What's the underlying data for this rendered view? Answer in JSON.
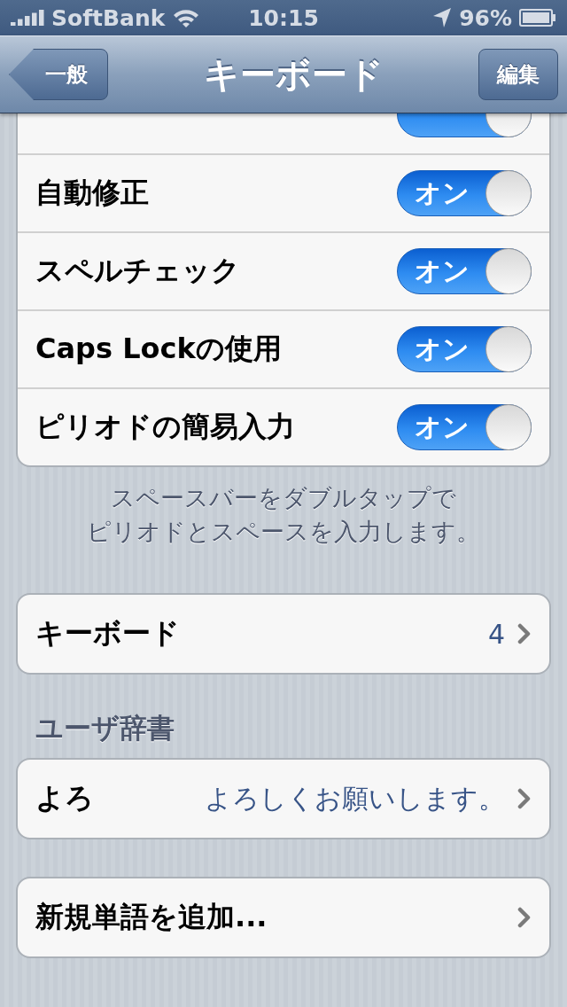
{
  "status_bar": {
    "carrier": "SoftBank",
    "time": "10:15",
    "battery": "96%"
  },
  "nav_bar": {
    "back": "一般",
    "title": "キーボード",
    "action": "編集"
  },
  "toggles": [
    {
      "on": true
    },
    {
      "label": "自動修正",
      "on": true,
      "state_label": "オン"
    },
    {
      "label": "スペルチェック",
      "on": true,
      "state_label": "オン"
    },
    {
      "label": "Caps Lockの使用",
      "on": true,
      "state_label": "オン"
    },
    {
      "label": "ピリオドの簡易入力",
      "on": true,
      "state_label": "オン"
    }
  ],
  "toggles_footer": [
    "スペースバーをダブルタップで",
    "ピリオドとスペースを入力します。"
  ],
  "keyboard_row": {
    "label": "キーボード",
    "value": "4"
  },
  "dictionary": {
    "header": "ユーザ辞書",
    "entries": [
      {
        "shortcut": "よろ",
        "phrase": "よろしくお願いします。"
      }
    ]
  },
  "add_word": "新規単語を追加..."
}
